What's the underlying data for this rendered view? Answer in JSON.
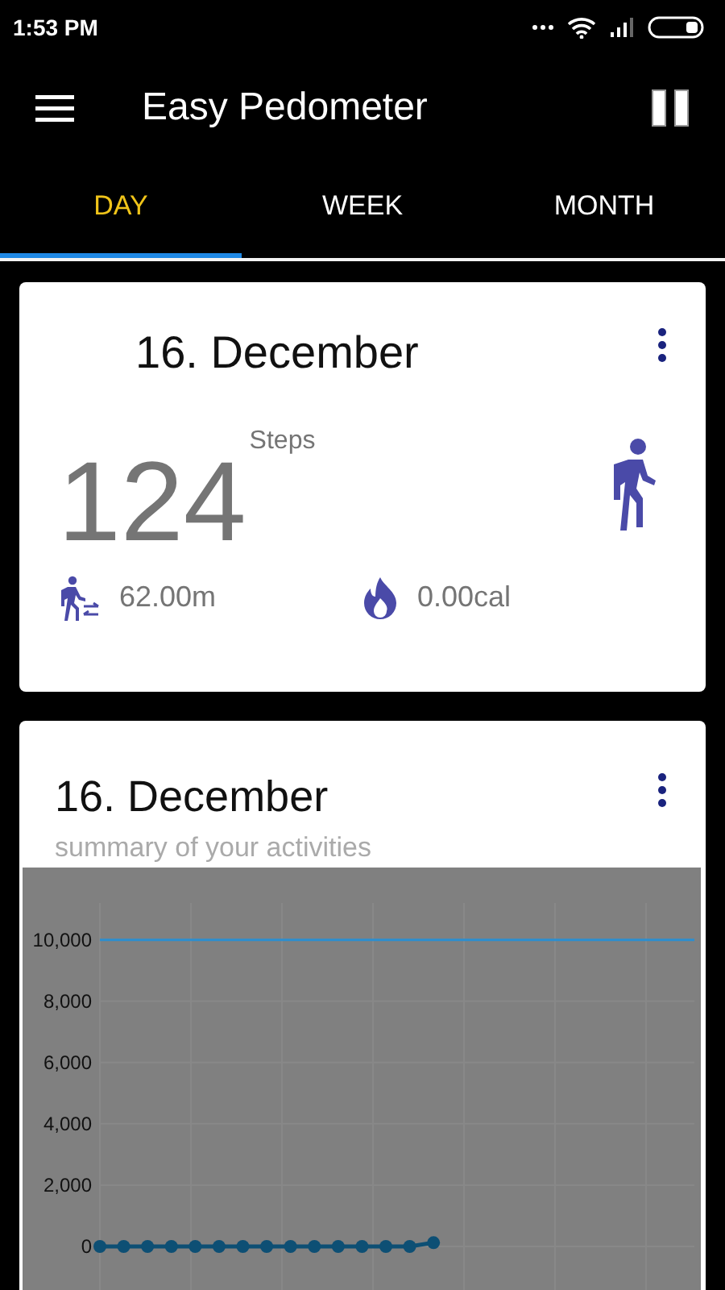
{
  "status_bar": {
    "time": "1:53 PM"
  },
  "toolbar": {
    "title": "Easy Pedometer"
  },
  "tabs": [
    {
      "label": "DAY",
      "selected": true
    },
    {
      "label": "WEEK",
      "selected": false
    },
    {
      "label": "MONTH",
      "selected": false
    }
  ],
  "today_card": {
    "date": "16. December",
    "steps": "124",
    "steps_unit": "Steps",
    "distance": "62.00m",
    "calories": "0.00cal"
  },
  "summary_card": {
    "date": "16. December",
    "subtitle": "summary of your activities",
    "chart_data": {
      "type": "line",
      "categories": [
        null,
        null,
        null,
        null,
        null,
        null,
        null,
        null,
        null,
        null,
        null,
        null,
        null,
        null,
        null,
        null,
        null,
        null,
        null,
        null,
        null,
        null,
        null,
        null,
        null
      ],
      "ylim": [
        0,
        11200
      ],
      "yticks": [
        {
          "value": 0,
          "label": "0"
        },
        {
          "value": 2000,
          "label": "2,000"
        },
        {
          "value": 4000,
          "label": "4,000"
        },
        {
          "value": 6000,
          "label": "6,000"
        },
        {
          "value": 8000,
          "label": "8,000"
        },
        {
          "value": 10000,
          "label": "10,000"
        }
      ],
      "grid": true,
      "series": [
        {
          "color": "#0d4f74",
          "marker": "circle",
          "values": [
            0,
            0,
            0,
            0,
            0,
            0,
            0,
            0,
            0,
            0,
            0,
            0,
            0,
            0,
            124,
            null,
            null,
            null,
            null,
            null,
            null,
            null,
            null,
            null,
            null
          ]
        }
      ],
      "ref_lines": [
        {
          "axis": "y",
          "value": 10000,
          "color": "#2b8ed0"
        }
      ]
    }
  }
}
